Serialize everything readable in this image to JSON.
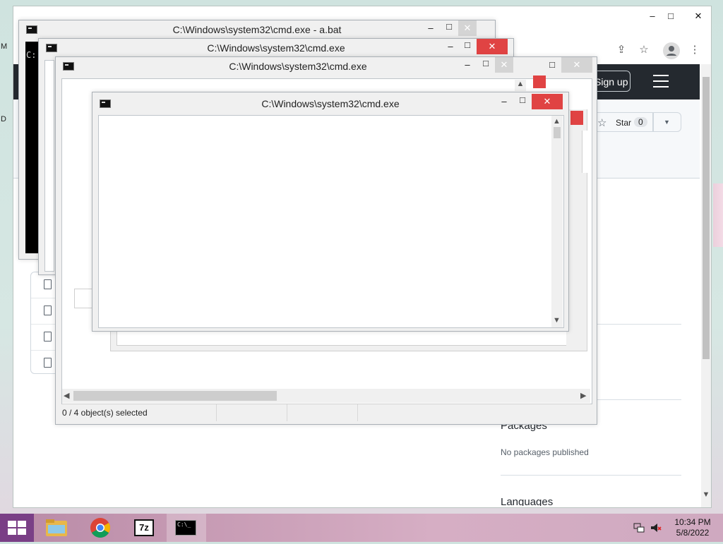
{
  "desktop": {
    "left_letters": [
      "M",
      "D"
    ]
  },
  "browser": {
    "controls": {
      "minimize": "–",
      "maximize": "□",
      "close": "✕"
    },
    "github": {
      "sign_up": "Sign up",
      "star_label": "Star",
      "star_count": "0"
    },
    "sidebar": {
      "packages_heading": "Packages",
      "packages_text": "No packages published",
      "languages_heading": "Languages"
    }
  },
  "windows": [
    {
      "title": "C:\\Windows\\system32\\cmd.exe - a.bat",
      "prompt": "C:"
    },
    {
      "title": "C:\\Windows\\system32\\cmd.exe"
    },
    {
      "title": "C:\\Windows\\system32\\cmd.exe",
      "status": "0 / 4 object(s) selected"
    },
    {
      "title": "C:\\Windows\\system32\\cmd.exe"
    }
  ],
  "taskbar": {
    "apps": [
      "File Explorer",
      "Google Chrome",
      "7-Zip",
      "Command Prompt"
    ],
    "sevenzip_label": "7z",
    "cmd_label": "C:\\_",
    "time": "10:34 PM",
    "date": "5/8/2022"
  },
  "colors": {
    "close_red": "#e04343",
    "github_dark": "#24292f",
    "start_purple": "#7a3f86"
  }
}
